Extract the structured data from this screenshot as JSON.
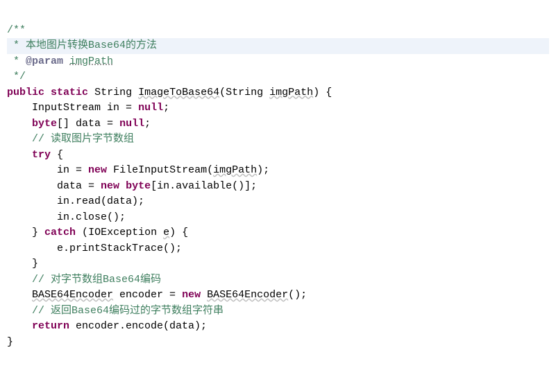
{
  "doc": {
    "open": "/**",
    "line1_prefix": " * ",
    "line1_text": "本地图片转换Base64的方法",
    "line2_prefix": " * ",
    "line2_tag": "@param",
    "line2_space": " ",
    "line2_param": "imgPath",
    "close": " */"
  },
  "sig": {
    "kw_public": "public",
    "kw_static": "static",
    "ret_type": "String",
    "method": "ImageToBase64",
    "lparen": "(",
    "param_type": "String",
    "param_name": "imgPath",
    "rparen_brace": ") {"
  },
  "l1": {
    "indent": "    ",
    "type": "InputStream",
    "rest": " in = ",
    "kw_null": "null",
    "semi": ";"
  },
  "l2": {
    "indent": "    ",
    "kw_byte": "byte",
    "brackets": "[]",
    "rest": " data = ",
    "kw_null": "null",
    "semi": ";"
  },
  "c1": {
    "indent": "    ",
    "text": "// 读取图片字节数组"
  },
  "l3": {
    "indent": "    ",
    "kw_try": "try",
    "brace": " {"
  },
  "l4": {
    "indent": "        ",
    "pre": "in = ",
    "kw_new": "new",
    "sp": " ",
    "ctor": "FileInputStream",
    "lp": "(",
    "arg": "imgPath",
    "rp": ");"
  },
  "l5": {
    "indent": "        ",
    "pre": "data = ",
    "kw_new": "new",
    "sp": " ",
    "kw_byte": "byte",
    "lb": "[",
    "expr": "in.available()",
    "rb": "];"
  },
  "l6": {
    "indent": "        ",
    "text": "in.read(data);"
  },
  "l7": {
    "indent": "        ",
    "text": "in.close();"
  },
  "l8": {
    "indent": "    ",
    "close": "} ",
    "kw_catch": "catch",
    "sp": " (",
    "ex_type": "IOException",
    "sp2": " ",
    "ex_var": "e",
    "rest": ") {"
  },
  "l9": {
    "indent": "        ",
    "text": "e.printStackTrace();"
  },
  "l10": {
    "indent": "    ",
    "text": "}"
  },
  "c2": {
    "indent": "    ",
    "text": "// 对字节数组Base64编码"
  },
  "l11": {
    "indent": "    ",
    "type": "BASE64Encoder",
    "mid": " encoder = ",
    "kw_new": "new",
    "sp": " ",
    "ctor": "BASE64Encoder",
    "rest": "();"
  },
  "c3": {
    "indent": "    ",
    "text": "// 返回Base64编码过的字节数组字符串"
  },
  "l12": {
    "indent": "    ",
    "kw_return": "return",
    "rest": " encoder.encode(data);"
  },
  "l13": {
    "text": "}"
  }
}
